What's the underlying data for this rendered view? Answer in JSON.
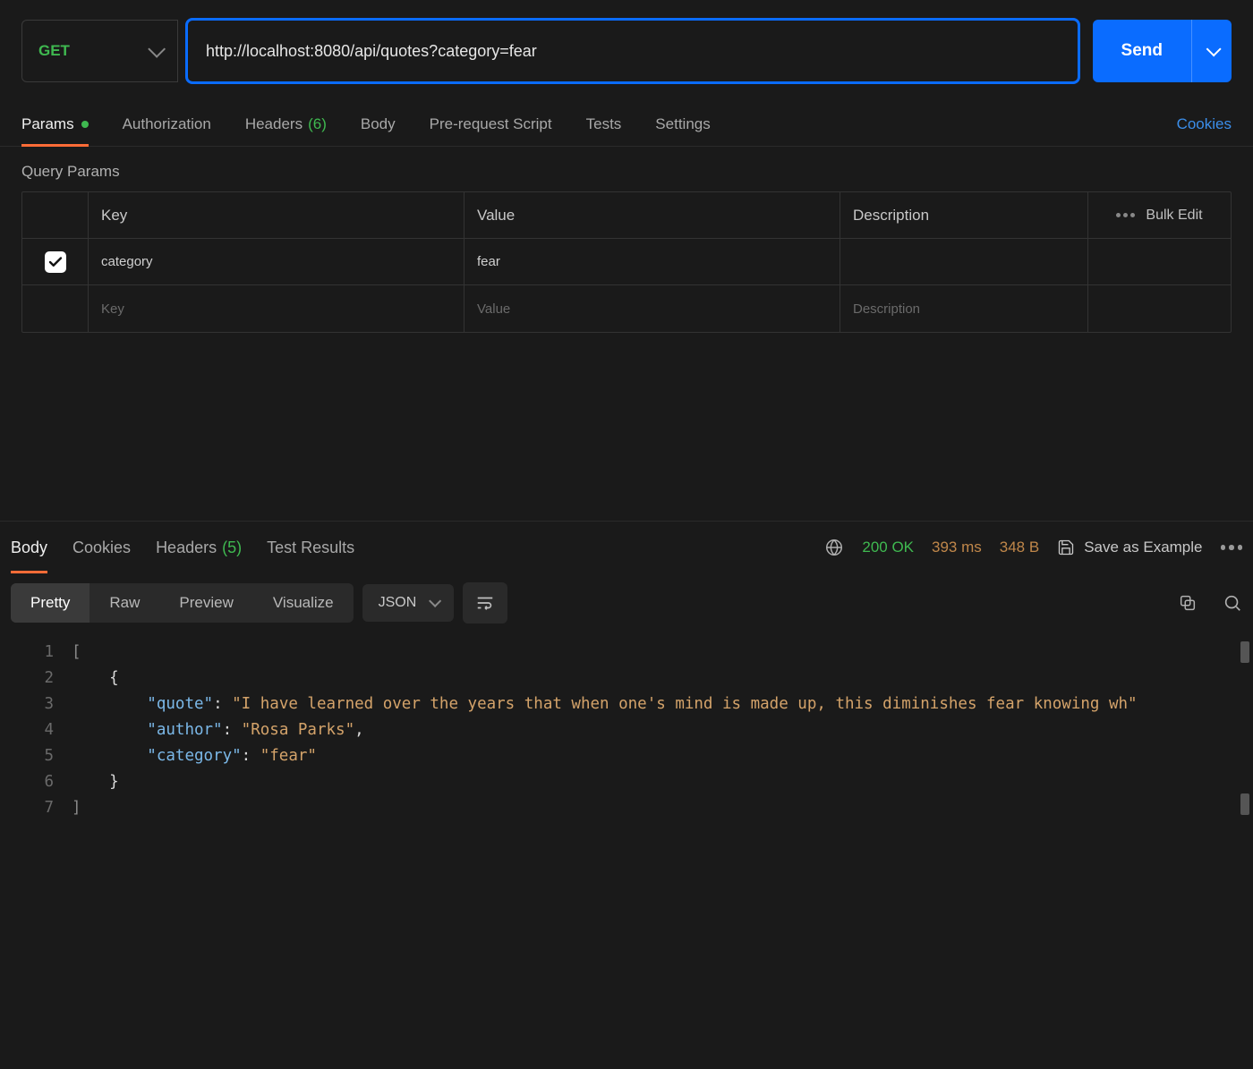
{
  "request": {
    "method": "GET",
    "url": "http://localhost:8080/api/quotes?category=fear",
    "send_label": "Send"
  },
  "req_tabs": {
    "params": "Params",
    "authorization": "Authorization",
    "headers": "Headers",
    "headers_count": "(6)",
    "body": "Body",
    "prerequest": "Pre-request Script",
    "tests": "Tests",
    "settings": "Settings",
    "cookies": "Cookies"
  },
  "query_params": {
    "title": "Query Params",
    "cols": {
      "key": "Key",
      "value": "Value",
      "description": "Description"
    },
    "bulk_edit": "Bulk Edit",
    "rows": [
      {
        "checked": true,
        "key": "category",
        "value": "fear",
        "description": ""
      }
    ],
    "placeholders": {
      "key": "Key",
      "value": "Value",
      "description": "Description"
    }
  },
  "response": {
    "tabs": {
      "body": "Body",
      "cookies": "Cookies",
      "headers": "Headers",
      "headers_count": "(5)",
      "test_results": "Test Results"
    },
    "status": "200 OK",
    "time": "393 ms",
    "size": "348 B",
    "save_example": "Save as Example",
    "view_modes": {
      "pretty": "Pretty",
      "raw": "Raw",
      "preview": "Preview",
      "visualize": "Visualize"
    },
    "format": "JSON",
    "body_json": [
      {
        "quote": "I have learned over the years that when one's mind is made up, this diminishes fear knowing wh",
        "author": "Rosa Parks",
        "category": "fear"
      }
    ],
    "line_numbers": [
      "1",
      "2",
      "3",
      "4",
      "5",
      "6",
      "7"
    ]
  }
}
